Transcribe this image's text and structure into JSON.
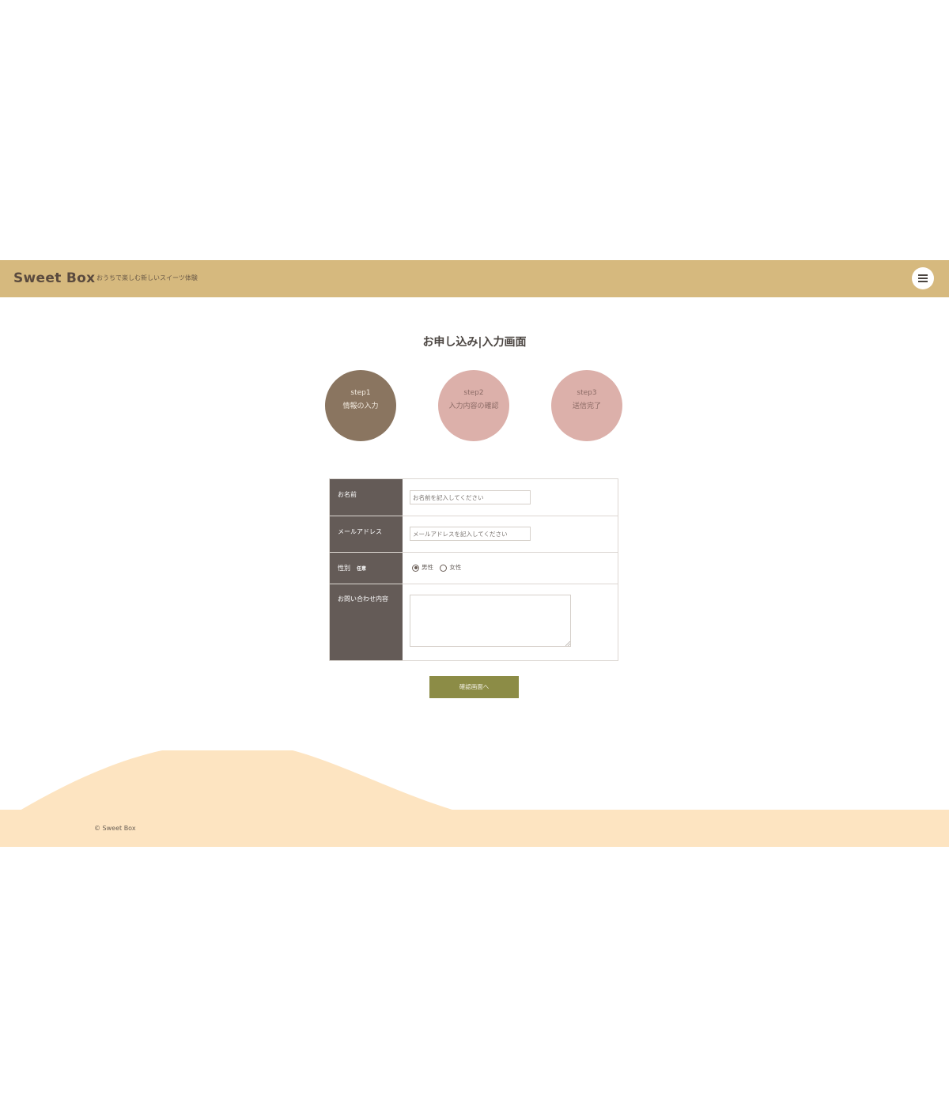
{
  "header": {
    "logo": "Sweet Box",
    "tagline": "おうちで楽しむ新しいスイーツ体験",
    "menu_icon": "hamburger-menu-icon"
  },
  "page": {
    "title": "お申し込み|入力画面"
  },
  "steps": [
    {
      "number": "step1",
      "name": "情報の入力",
      "state": "active"
    },
    {
      "number": "step2",
      "name": "入力内容の確認",
      "state": "pending"
    },
    {
      "number": "step3",
      "name": "送信完了",
      "state": "pending"
    }
  ],
  "form": {
    "name": {
      "label": "お名前",
      "value": "",
      "placeholder": "お名前を記入してください"
    },
    "email": {
      "label": "メールアドレス",
      "value": "",
      "placeholder": "メールアドレスを記入してください"
    },
    "gender": {
      "label": "性別",
      "badge": "任意",
      "options": [
        "男性",
        "女性"
      ],
      "selected": "男性"
    },
    "message": {
      "label": "お問い合わせ内容",
      "value": ""
    },
    "submit_label": "確認画面へ"
  },
  "footer": {
    "copyright": "© Sweet Box"
  },
  "colors": {
    "header_bg": "#d6b97e",
    "step_active": "#8a7560",
    "step_pending": "#dcb0aa",
    "label_column": "#645b57",
    "submit_button": "#8c8c46",
    "footer_bg": "#fde4c1"
  }
}
